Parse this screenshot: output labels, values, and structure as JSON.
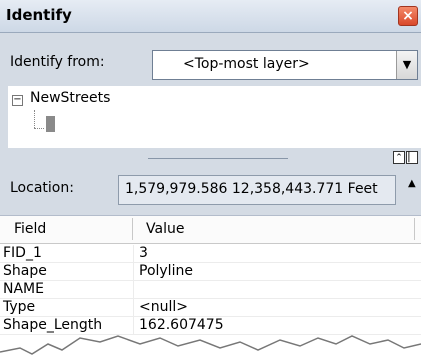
{
  "window": {
    "title": "Identify",
    "close_label": "×"
  },
  "identify_from": {
    "label": "Identify from:",
    "selected": "<Top-most layer>"
  },
  "tree": {
    "layers": [
      {
        "name": "NewStreets",
        "expanded": true
      }
    ]
  },
  "location": {
    "label": "Location:",
    "value": "1,579,979.586  12,358,443.771 Feet"
  },
  "table": {
    "headers": {
      "field": "Field",
      "value": "Value"
    },
    "rows": [
      {
        "field": "FID_1",
        "value": "3"
      },
      {
        "field": "Shape",
        "value": "Polyline"
      },
      {
        "field": "NAME",
        "value": ""
      },
      {
        "field": "Type",
        "value": "<null>"
      },
      {
        "field": "Shape_Length",
        "value": "162.607475"
      }
    ]
  },
  "icons": {
    "close": "close-icon",
    "dropdown": "chevron-down-icon",
    "collapse": "collapse-icon",
    "expand_panel": "double-chevron-up-icon",
    "panel_toggle": "panel-toggle-icon",
    "location_options": "location-menu-icon"
  },
  "colors": {
    "panel_bg": "#d4dbe4",
    "titlebar_bg": "#cdd8e6",
    "close_button": "#e05a36",
    "location_bg": "#e4e9f0"
  }
}
